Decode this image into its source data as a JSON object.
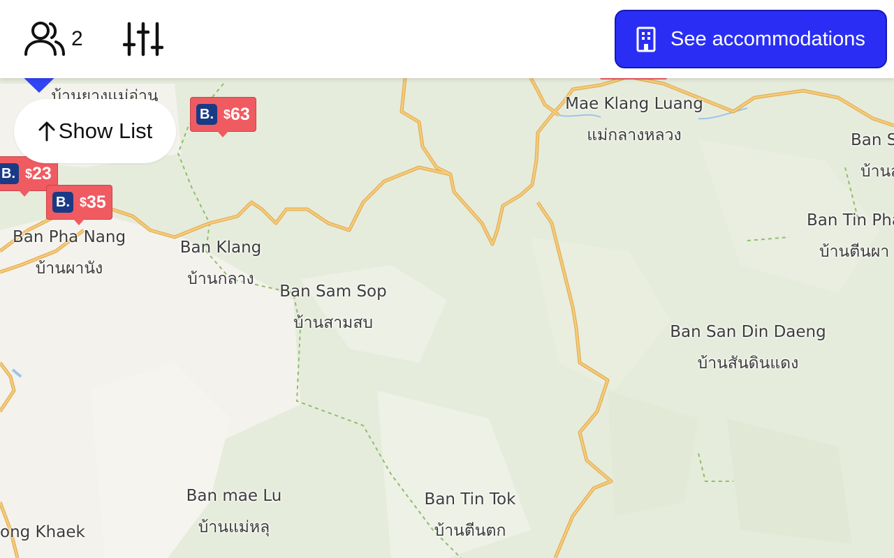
{
  "topbar": {
    "guest_count": "2",
    "see_accommodations_label": "See accommodations",
    "icons": {
      "guests": "users-icon",
      "filters": "sliders-icon",
      "building": "building-icon"
    }
  },
  "show_list": {
    "label": "Show List",
    "icon": "arrow-up-icon"
  },
  "price_tags": [
    {
      "price": "63",
      "currency": "$",
      "logo": "B."
    },
    {
      "price": "23",
      "currency": "$",
      "logo": "B."
    },
    {
      "price": "35",
      "currency": "$",
      "logo": "B."
    }
  ],
  "places": [
    {
      "en": "Mae Klang Luang",
      "th": "แม่กลางหลวง"
    },
    {
      "en": "Ban Pha Nang",
      "th": "บ้านผานัง"
    },
    {
      "en": "Ban Klang",
      "th": "บ้านกลาง"
    },
    {
      "en": "Ban Sam Sop",
      "th": "บ้านสามสบ"
    },
    {
      "en": "Ban Tin Pha",
      "th": "บ้านตีนผา"
    },
    {
      "en": "Ban San Din Daeng",
      "th": "บ้านสันดินแดง"
    },
    {
      "en": "Ban mae Lu",
      "th": "บ้านแม่หลุ"
    },
    {
      "en": "Ban Tin Tok",
      "th": "บ้านตีนตก"
    },
    {
      "en": "ong Khaek",
      "th": ""
    },
    {
      "en": "Ban S",
      "th": "บ้านส"
    },
    {
      "en": "",
      "th": "บ้านยางแม่อ่าน"
    }
  ],
  "colors": {
    "accent": "#2a2ef5",
    "price_tag": "#ef5b61",
    "booking_logo": "#1a3a86",
    "map_base": "#e6ecdc",
    "road": "#f2c572",
    "pin": "#3344f5"
  }
}
